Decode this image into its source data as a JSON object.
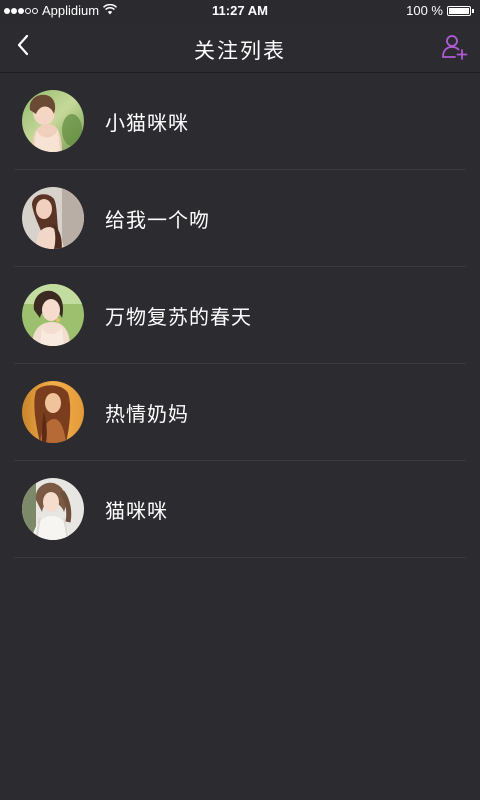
{
  "status_bar": {
    "carrier": "Applidium",
    "time": "11:27 AM",
    "battery_text": "100 %",
    "battery_level": 1.0,
    "signal_bars_filled": 3,
    "signal_bars_total": 5
  },
  "nav": {
    "title": "关注列表",
    "back_icon": "chevron-left-icon",
    "add_icon": "add-user-icon",
    "accent_color": "#b05ad8"
  },
  "follow_list": [
    {
      "name": "小猫咪咪"
    },
    {
      "name": "给我一个吻"
    },
    {
      "name": "万物复苏的春天"
    },
    {
      "name": "热情奶妈"
    },
    {
      "name": "猫咪咪"
    }
  ]
}
